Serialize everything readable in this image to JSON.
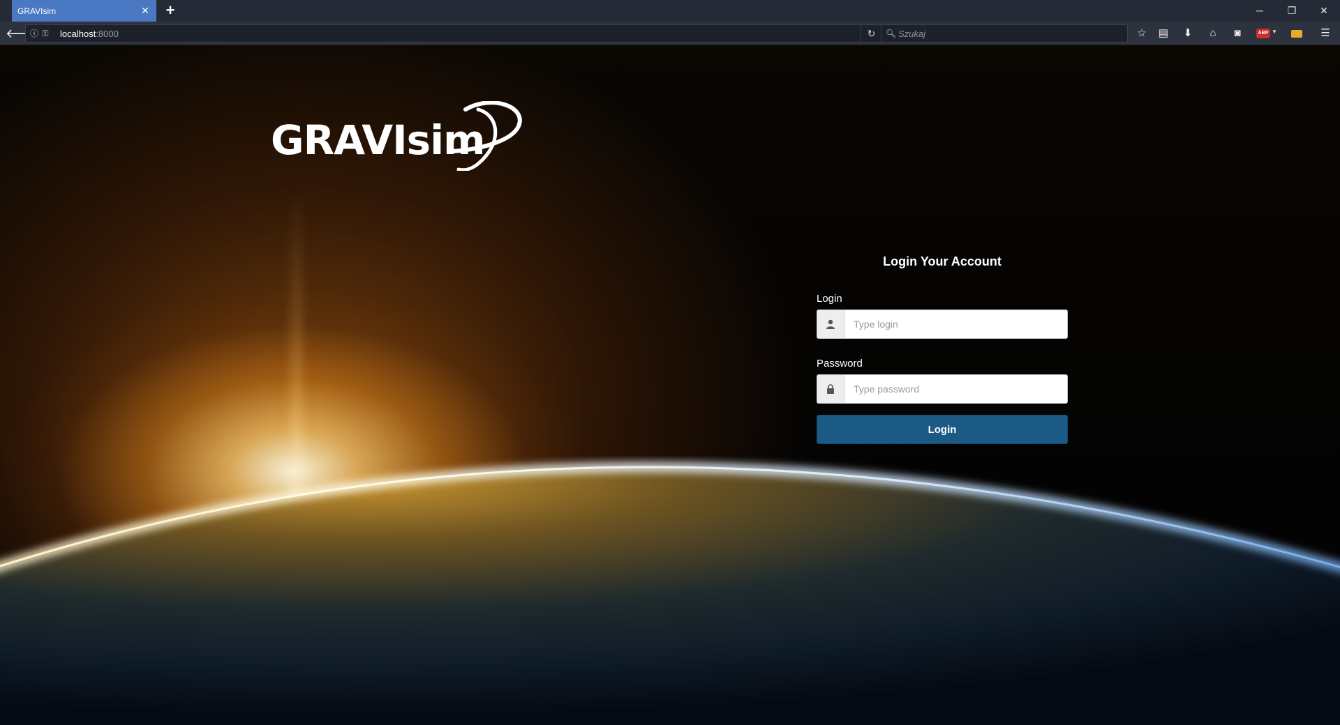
{
  "browser": {
    "tab": {
      "title": "GRAVIsim",
      "close_icon": "close-icon"
    },
    "new_tab_icon": "plus-icon",
    "window_controls": [
      "minimize-icon",
      "restore-icon",
      "close-icon"
    ],
    "url": {
      "host": "localhost",
      "port": ":8000"
    },
    "search_placeholder": "Szukaj",
    "toolbar_icons": [
      "star-icon",
      "reading-list-icon",
      "download-icon",
      "home-icon",
      "pocket-icon",
      "adblock-icon",
      "extension-icon",
      "menu-icon"
    ],
    "adblock_label": "ABP"
  },
  "page": {
    "logo_text": "GRAVIsim",
    "login": {
      "title": "Login Your Account",
      "login_label": "Login",
      "login_placeholder": "Type login",
      "login_value": "",
      "password_label": "Password",
      "password_placeholder": "Type password",
      "password_value": "",
      "submit_label": "Login"
    }
  },
  "colors": {
    "tab_active": "#4a78c2",
    "login_button": "#1a5a84",
    "chrome_bg": "#252b36"
  }
}
